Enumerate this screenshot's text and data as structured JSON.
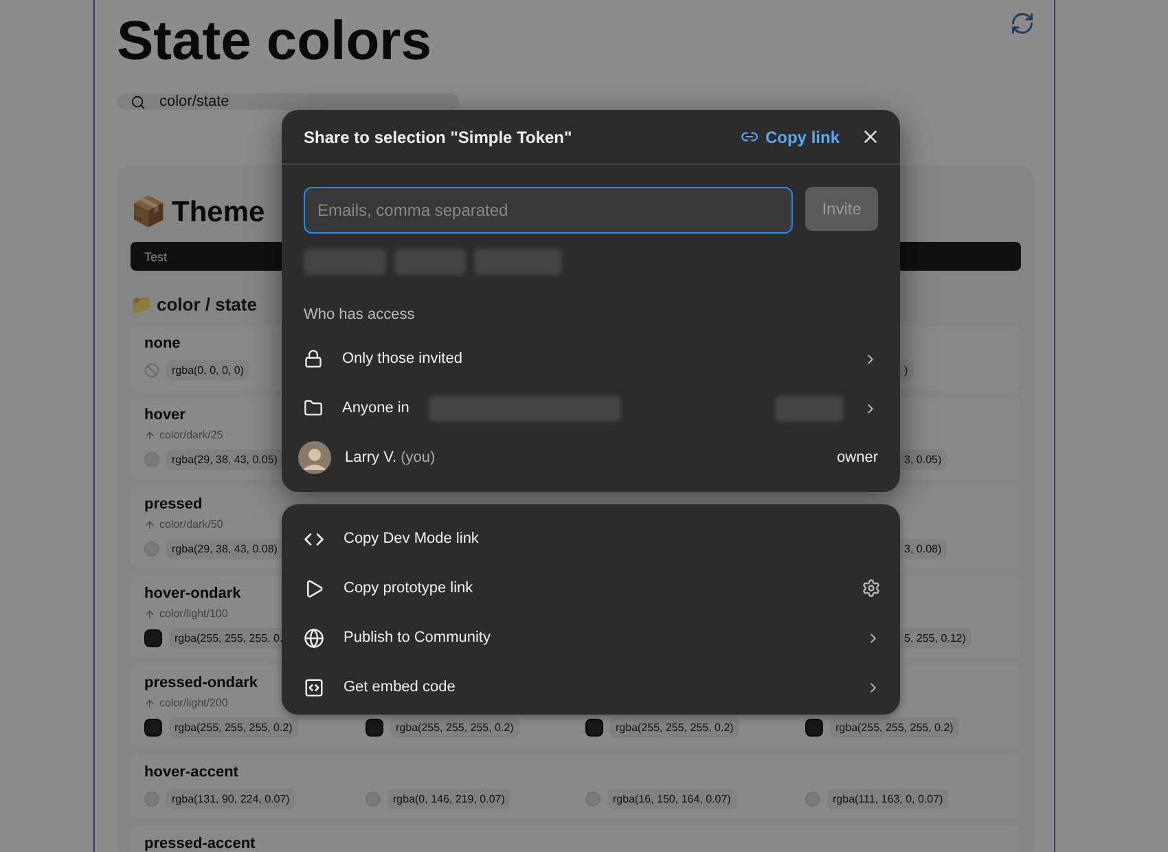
{
  "page": {
    "title": "State colors",
    "search": "color/state"
  },
  "theme": {
    "title": "Theme",
    "emoji": "📦",
    "bar_label": "Test",
    "group_emoji": "📁",
    "group": "color / state",
    "rows": [
      {
        "name": "none",
        "kind": "empty",
        "values": [
          "rgba(0, 0, 0, 0)"
        ],
        "tail": ")"
      },
      {
        "name": "hover",
        "token": "color/dark/25",
        "kind": "light",
        "values": [
          "rgba(29, 38, 43, 0.05)"
        ],
        "tail": "3, 0.05)"
      },
      {
        "name": "pressed",
        "token": "color/dark/50",
        "kind": "light",
        "values": [
          "rgba(29, 38, 43, 0.08)"
        ],
        "tail": "3, 0.08)"
      },
      {
        "name": "hover-ondark",
        "token": "color/light/100",
        "kind": "dark",
        "values": [
          "rgba(255, 255, 255, 0."
        ],
        "tail": "5, 255, 0.12)"
      },
      {
        "name": "pressed-ondark",
        "token": "color/light/200",
        "kind": "dark",
        "values": [
          "rgba(255, 255, 255, 0.2)",
          "rgba(255, 255, 255, 0.2)",
          "rgba(255, 255, 255, 0.2)",
          "rgba(255, 255, 255, 0.2)"
        ]
      },
      {
        "name": "hover-accent",
        "kind": "light",
        "values": [
          "rgba(131, 90, 224, 0.07)",
          "rgba(0, 146, 219, 0.07)",
          "rgba(16, 150, 164, 0.07)",
          "rgba(111, 163, 0, 0.07)"
        ]
      },
      {
        "name": "pressed-accent",
        "kind": "heading"
      }
    ]
  },
  "dialog": {
    "title": "Share to selection \"Simple Token\"",
    "copy_link": "Copy link",
    "placeholder": "Emails, comma separated",
    "invite": "Invite",
    "invite_disabled": true,
    "access_heading": "Who has access",
    "access": [
      {
        "kind": "lock",
        "label": "Only those invited"
      },
      {
        "kind": "folder",
        "label": "Anyone in"
      },
      {
        "kind": "person",
        "label": "Larry V.",
        "suffix": "(you)",
        "role": "owner"
      }
    ]
  },
  "menu": [
    {
      "kind": "plain",
      "label": "Copy Dev Mode link"
    },
    {
      "kind": "settings",
      "label": "Copy prototype link"
    },
    {
      "kind": "submenu",
      "label": "Publish to Community"
    },
    {
      "kind": "submenu",
      "label": "Get embed code"
    }
  ]
}
